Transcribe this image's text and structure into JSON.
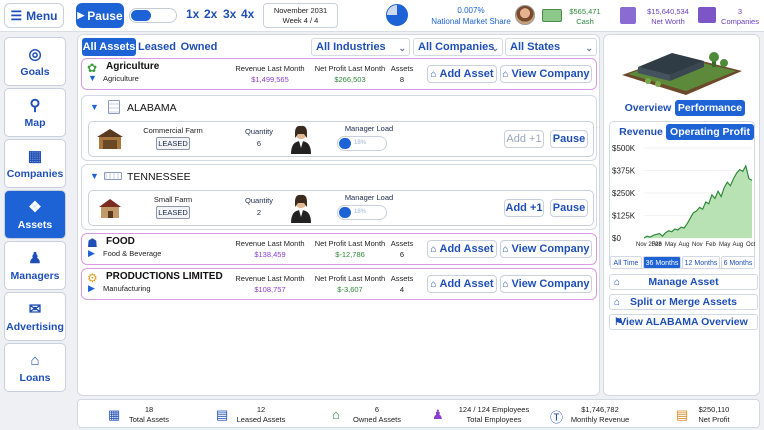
{
  "topbar": {
    "menu_label": "Menu",
    "pause_label": "Pause",
    "speeds": [
      "1x",
      "2x",
      "3x",
      "4x"
    ],
    "date_line1": "November 2031",
    "date_line2": "Week 4 / 4",
    "market_share_value": "0.007%",
    "market_share_label": "National Market Share",
    "cash_value": "$565,471",
    "cash_label": "Cash",
    "networth_value": "$15,640,534",
    "networth_label": "Net Worth",
    "companies_value": "3",
    "companies_label": "Companies"
  },
  "sidebar": {
    "items": [
      {
        "label": "Goals",
        "icon": "goals-icon"
      },
      {
        "label": "Map",
        "icon": "map-pin-icon"
      },
      {
        "label": "Companies",
        "icon": "companies-icon"
      },
      {
        "label": "Assets",
        "icon": "assets-icon",
        "active": true
      },
      {
        "label": "Managers",
        "icon": "managers-icon"
      },
      {
        "label": "Advertising",
        "icon": "megaphone-icon"
      },
      {
        "label": "Loans",
        "icon": "bank-icon"
      }
    ]
  },
  "filters": {
    "tabs": [
      "All Assets",
      "Leased",
      "Owned"
    ],
    "industry": "All Industries",
    "company": "All Companies",
    "state": "All States"
  },
  "industries": [
    {
      "name": "Agriculture",
      "sub": "Agriculture",
      "revenue_label": "Revenue Last Month",
      "revenue": "$1,499,565",
      "profit_label": "Net Profit Last Month",
      "profit": "$266,503",
      "assets_label": "Assets",
      "assets": "8",
      "add": "Add Asset",
      "view": "View Company"
    },
    {
      "name": "FOOD",
      "sub": "Food & Beverage",
      "revenue_label": "Revenue Last Month",
      "revenue": "$138,459",
      "profit_label": "Net Profit Last Month",
      "profit": "$-12,786",
      "assets_label": "Assets",
      "assets": "6",
      "add": "Add Asset",
      "view": "View Company"
    },
    {
      "name": "PRODUCTIONS LIMITED",
      "sub": "Manufacturing",
      "revenue_label": "Revenue Last Month",
      "revenue": "$108,757",
      "profit_label": "Net Profit Last Month",
      "profit": "$-3,607",
      "assets_label": "Assets",
      "assets": "4",
      "add": "Add Asset",
      "view": "View Company"
    }
  ],
  "states": [
    {
      "name": "ALABAMA",
      "asset": {
        "type": "Commercial Farm",
        "status": "LEASED",
        "qty_label": "Quantity",
        "qty": "6",
        "load_label": "Manager Load",
        "load_pct": "18%",
        "load_value": 0.18,
        "add": "Add +1",
        "pause": "Pause"
      }
    },
    {
      "name": "TENNESSEE",
      "asset": {
        "type": "Small Farm",
        "status": "LEASED",
        "qty_label": "Quantity",
        "qty": "2",
        "load_label": "Manager Load",
        "load_pct": "18%",
        "load_value": 0.18,
        "add": "Add +1",
        "pause": "Pause"
      }
    }
  ],
  "right_panel": {
    "view_tabs": [
      "Overview",
      "Performance"
    ],
    "metric_tabs": [
      "Revenue",
      "Operating Profit"
    ],
    "time_tabs": [
      "All Time",
      "36 Months",
      "12 Months",
      "6 Months"
    ],
    "actions": [
      "Manage Asset",
      "Split or Merge Assets",
      "View ALABAMA Overview"
    ]
  },
  "chart_data": {
    "type": "area",
    "x": [
      "Nov 2028",
      "Feb",
      "May",
      "Aug",
      "Nov",
      "Feb",
      "May",
      "Aug",
      "Nov",
      "Feb",
      "May",
      "Aug",
      "Nov",
      "Feb",
      "May",
      "Aug",
      "Nov",
      "Feb",
      "May",
      "Aug",
      "Nov",
      "Feb",
      "May",
      "Aug",
      "Nov",
      "Feb",
      "May",
      "Aug",
      "Nov",
      "Feb",
      "May",
      "Aug",
      "Nov",
      "Feb",
      "May",
      "Oct"
    ],
    "x_tick_labels": [
      "Nov 2028",
      "Feb",
      "May",
      "Aug",
      "Nov",
      "Feb",
      "May",
      "Aug",
      "Oct"
    ],
    "y_tick_labels": [
      "$500K",
      "$375K",
      "$250K",
      "$125K",
      "$0"
    ],
    "values": [
      0,
      10000,
      5000,
      15000,
      20000,
      25000,
      10000,
      30000,
      40000,
      35000,
      50000,
      45000,
      60000,
      55000,
      80000,
      110000,
      140000,
      150000,
      170000,
      160000,
      200000,
      190000,
      240000,
      220000,
      260000,
      230000,
      280000,
      310000,
      290000,
      330000,
      360000,
      380000,
      370000,
      400000,
      330000,
      320000
    ],
    "ylim": [
      0,
      500000
    ],
    "colors": {
      "line": "#2e8b3a",
      "fill": "#b9e2b4"
    }
  },
  "bottom_stats": [
    {
      "value": "18",
      "label": "Total Assets",
      "icon": "buildings-icon"
    },
    {
      "value": "12",
      "label": "Leased Assets",
      "icon": "lease-document-icon"
    },
    {
      "value": "6",
      "label": "Owned Assets",
      "icon": "home-icon"
    },
    {
      "value": "124 / 124 Employees",
      "label": "Total Employees",
      "icon": "employees-icon"
    },
    {
      "value": "$1,746,782",
      "label": "Monthly Revenue",
      "icon": "dollar-circle-icon"
    },
    {
      "value": "$250,110",
      "label": "Net Profit",
      "icon": "profit-chart-icon"
    }
  ]
}
